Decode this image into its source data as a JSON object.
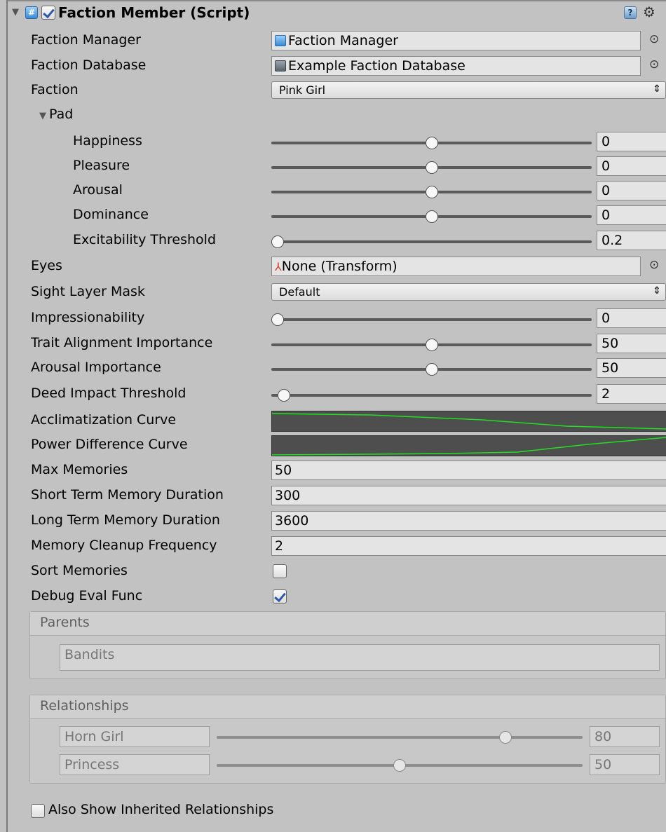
{
  "component": {
    "title": "Faction Member (Script)",
    "enabled": true
  },
  "fields": {
    "faction_manager": {
      "label": "Faction Manager",
      "value": "Faction Manager"
    },
    "faction_database": {
      "label": "Faction Database",
      "value": "Example Faction Database"
    },
    "faction": {
      "label": "Faction",
      "value": "Pink Girl"
    },
    "pad": {
      "label": "Pad",
      "items": [
        {
          "label": "Happiness",
          "value": "0",
          "fraction": 0.5
        },
        {
          "label": "Pleasure",
          "value": "0",
          "fraction": 0.5
        },
        {
          "label": "Arousal",
          "value": "0",
          "fraction": 0.5
        },
        {
          "label": "Dominance",
          "value": "0",
          "fraction": 0.5
        },
        {
          "label": "Excitability Threshold",
          "value": "0.2",
          "fraction": 0.0
        }
      ]
    },
    "eyes": {
      "label": "Eyes",
      "value": "None (Transform)"
    },
    "sight_layer_mask": {
      "label": "Sight Layer Mask",
      "value": "Default"
    },
    "impressionability": {
      "label": "Impressionability",
      "value": "0",
      "fraction": 0.0
    },
    "trait_alignment_importance": {
      "label": "Trait Alignment Importance",
      "value": "50",
      "fraction": 0.5
    },
    "arousal_importance": {
      "label": "Arousal Importance",
      "value": "50",
      "fraction": 0.5
    },
    "deed_impact_threshold": {
      "label": "Deed Impact Threshold",
      "value": "2",
      "fraction": 0.02
    },
    "acclimatization_curve": {
      "label": "Acclimatization Curve"
    },
    "power_difference_curve": {
      "label": "Power Difference Curve"
    },
    "max_memories": {
      "label": "Max Memories",
      "value": "50"
    },
    "short_term_memory_duration": {
      "label": "Short Term Memory Duration",
      "value": "300"
    },
    "long_term_memory_duration": {
      "label": "Long Term Memory Duration",
      "value": "3600"
    },
    "memory_cleanup_frequency": {
      "label": "Memory Cleanup Frequency",
      "value": "2"
    },
    "sort_memories": {
      "label": "Sort Memories",
      "checked": false
    },
    "debug_eval_func": {
      "label": "Debug Eval Func",
      "checked": true
    }
  },
  "parents": {
    "header": "Parents",
    "items": [
      "Bandits"
    ]
  },
  "relationships": {
    "header": "Relationships",
    "items": [
      {
        "name": "Horn Girl",
        "value": "80",
        "fraction": 0.8
      },
      {
        "name": "Princess",
        "value": "50",
        "fraction": 0.5
      }
    ]
  },
  "also_show_inherited": {
    "label": "Also Show Inherited Relationships",
    "checked": false
  },
  "colors": {
    "curve_line": "#21e021",
    "curve_bg": "#4e4e4e",
    "panel_bg": "#c2c2c2"
  },
  "icons": {
    "header_fold": "triangle-down-icon",
    "script": "script-icon",
    "help": "help-book-icon",
    "settings": "gear-icon",
    "object_picker": "object-picker-icon",
    "transform": "transform-axes-icon"
  }
}
